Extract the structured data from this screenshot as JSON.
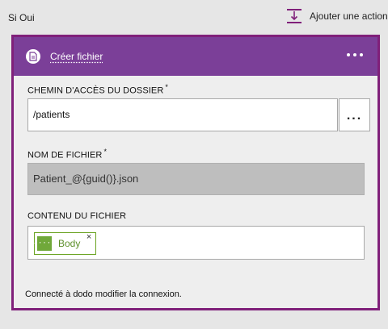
{
  "branch": {
    "label": "Si Oui"
  },
  "add_action": {
    "label": "Ajouter une action",
    "icon": "add-action-icon"
  },
  "card": {
    "title": "Créer fichier",
    "header_color": "#7b3f98",
    "border_color": "#80207a",
    "icon": "file-icon",
    "menu_icon": "ellipsis-icon"
  },
  "fields": {
    "folder_path": {
      "label": "CHEMIN D'ACCÈS DU DOSSIER",
      "required_mark": "*",
      "value": "/patients",
      "browse_label": "..."
    },
    "file_name": {
      "label": "NOM DE FICHIER",
      "required_mark": "*",
      "value": "Patient_@{guid()}.json"
    },
    "file_content": {
      "label": "CONTENU DU FICHIER",
      "token": {
        "label": "Body",
        "icon_glyph": "{···}",
        "remove_glyph": "×",
        "color": "#70a83a"
      }
    }
  },
  "connection": {
    "prefix": "Connecté à dodo",
    "link": "modifier la connexion."
  }
}
